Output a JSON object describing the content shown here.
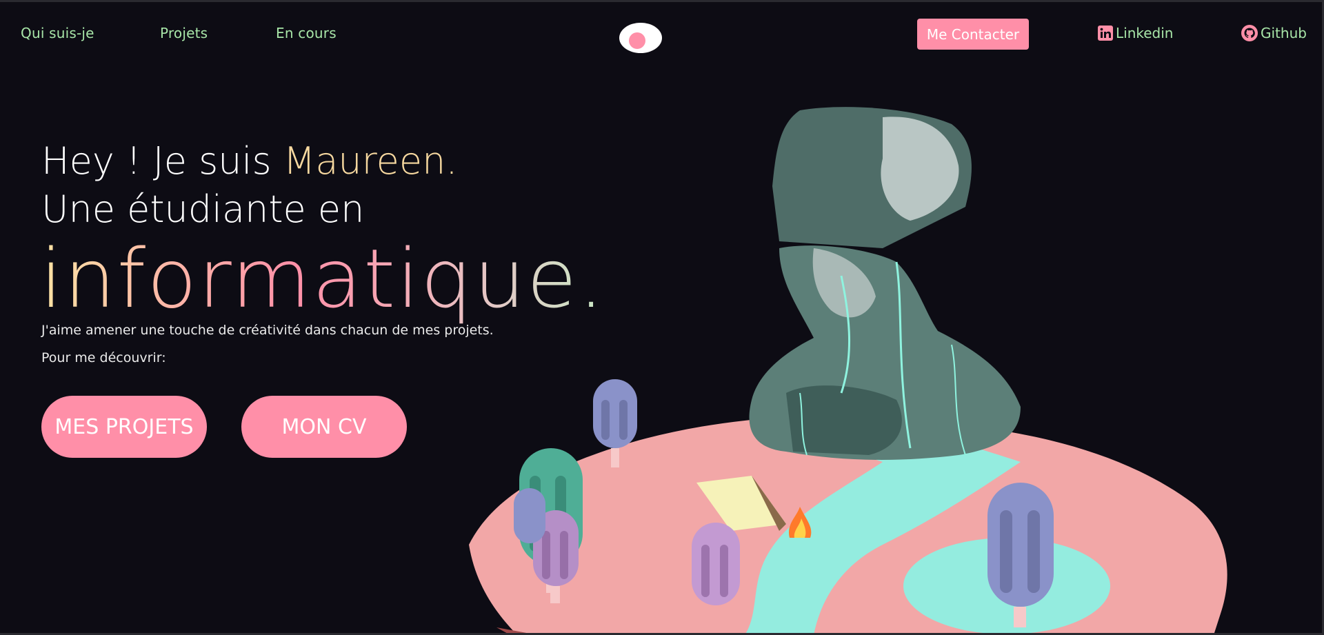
{
  "nav": {
    "about": "Qui suis-je",
    "projects": "Projets",
    "ongoing": "En cours",
    "contact": "Me Contacter",
    "linkedin": "Linkedin",
    "github": "Github"
  },
  "hero": {
    "line1_prefix": "Hey ! Je suis ",
    "name": "Maureen.",
    "line2": "Une étudiante en",
    "big": "informatique.",
    "intro": "J'aime amener une touche de créativité dans chacun de mes projets.",
    "discover": "Pour me découvrir:",
    "btn_projects": "MES PROJETS",
    "btn_cv": "MON CV"
  },
  "colors": {
    "background": "#0d0c14",
    "accent_pink": "#ff8fa8",
    "nav_green": "#a8e6a8",
    "name_yellow": "#f7d9a0"
  },
  "icons": {
    "logo": "eye-logo-icon",
    "linkedin": "linkedin-icon",
    "github": "github-icon"
  }
}
